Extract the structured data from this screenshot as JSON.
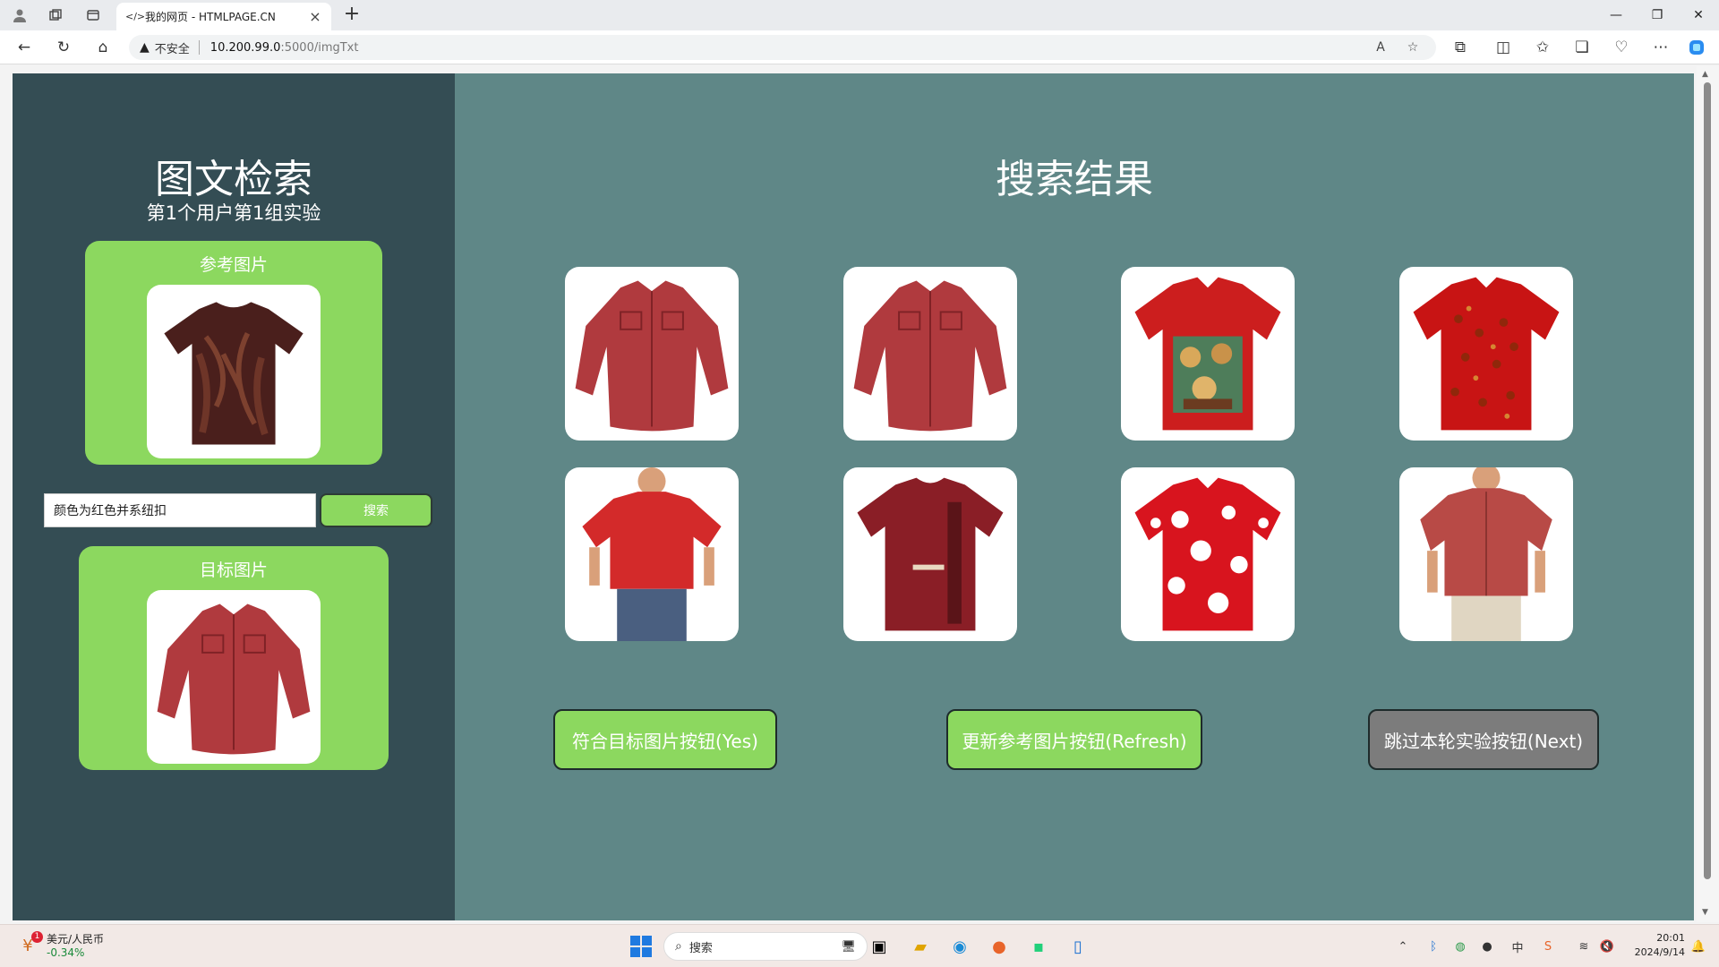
{
  "browser": {
    "tab_title": "我的网页 - HTMLPAGE.CN",
    "address": {
      "security_label": "不安全",
      "host": "10.200.99.0",
      "path": ":5000/imgTxt"
    }
  },
  "page": {
    "left": {
      "title": "图文检索",
      "subtitle": "第1个用户第1组实验",
      "reference_label": "参考图片",
      "target_label": "目标图片",
      "search_value": "颜色为红色并系纽扣",
      "search_button": "搜索"
    },
    "right": {
      "title": "搜索结果",
      "results": [
        {
          "desc": "red long-sleeve button shirt"
        },
        {
          "desc": "red long-sleeve button shirt"
        },
        {
          "desc": "red hawaiian shirt with dogs playing poker"
        },
        {
          "desc": "red hawaiian shirt with floral print"
        },
        {
          "desc": "man wearing red polo shirt"
        },
        {
          "desc": "dark red harley-davidson t-shirt"
        },
        {
          "desc": "red hawaiian shirt with white hibiscus"
        },
        {
          "desc": "man wearing red short-sleeve shirt"
        }
      ],
      "buttons": {
        "yes": "符合目标图片按钮(Yes)",
        "refresh": "更新参考图片按钮(Refresh)",
        "next": "跳过本轮实验按钮(Next)"
      }
    }
  },
  "taskbar": {
    "widget_title": "美元/人民币",
    "widget_value": "-0.34%",
    "widget_badge": "1",
    "search_label": "搜索",
    "ime_label": "中",
    "clock_time": "20:01",
    "clock_date": "2024/9/14"
  },
  "colors": {
    "left_panel": "#344d54",
    "right_panel": "#5f8787",
    "green": "#8cd85f",
    "gray_button": "#7c7c7c"
  }
}
